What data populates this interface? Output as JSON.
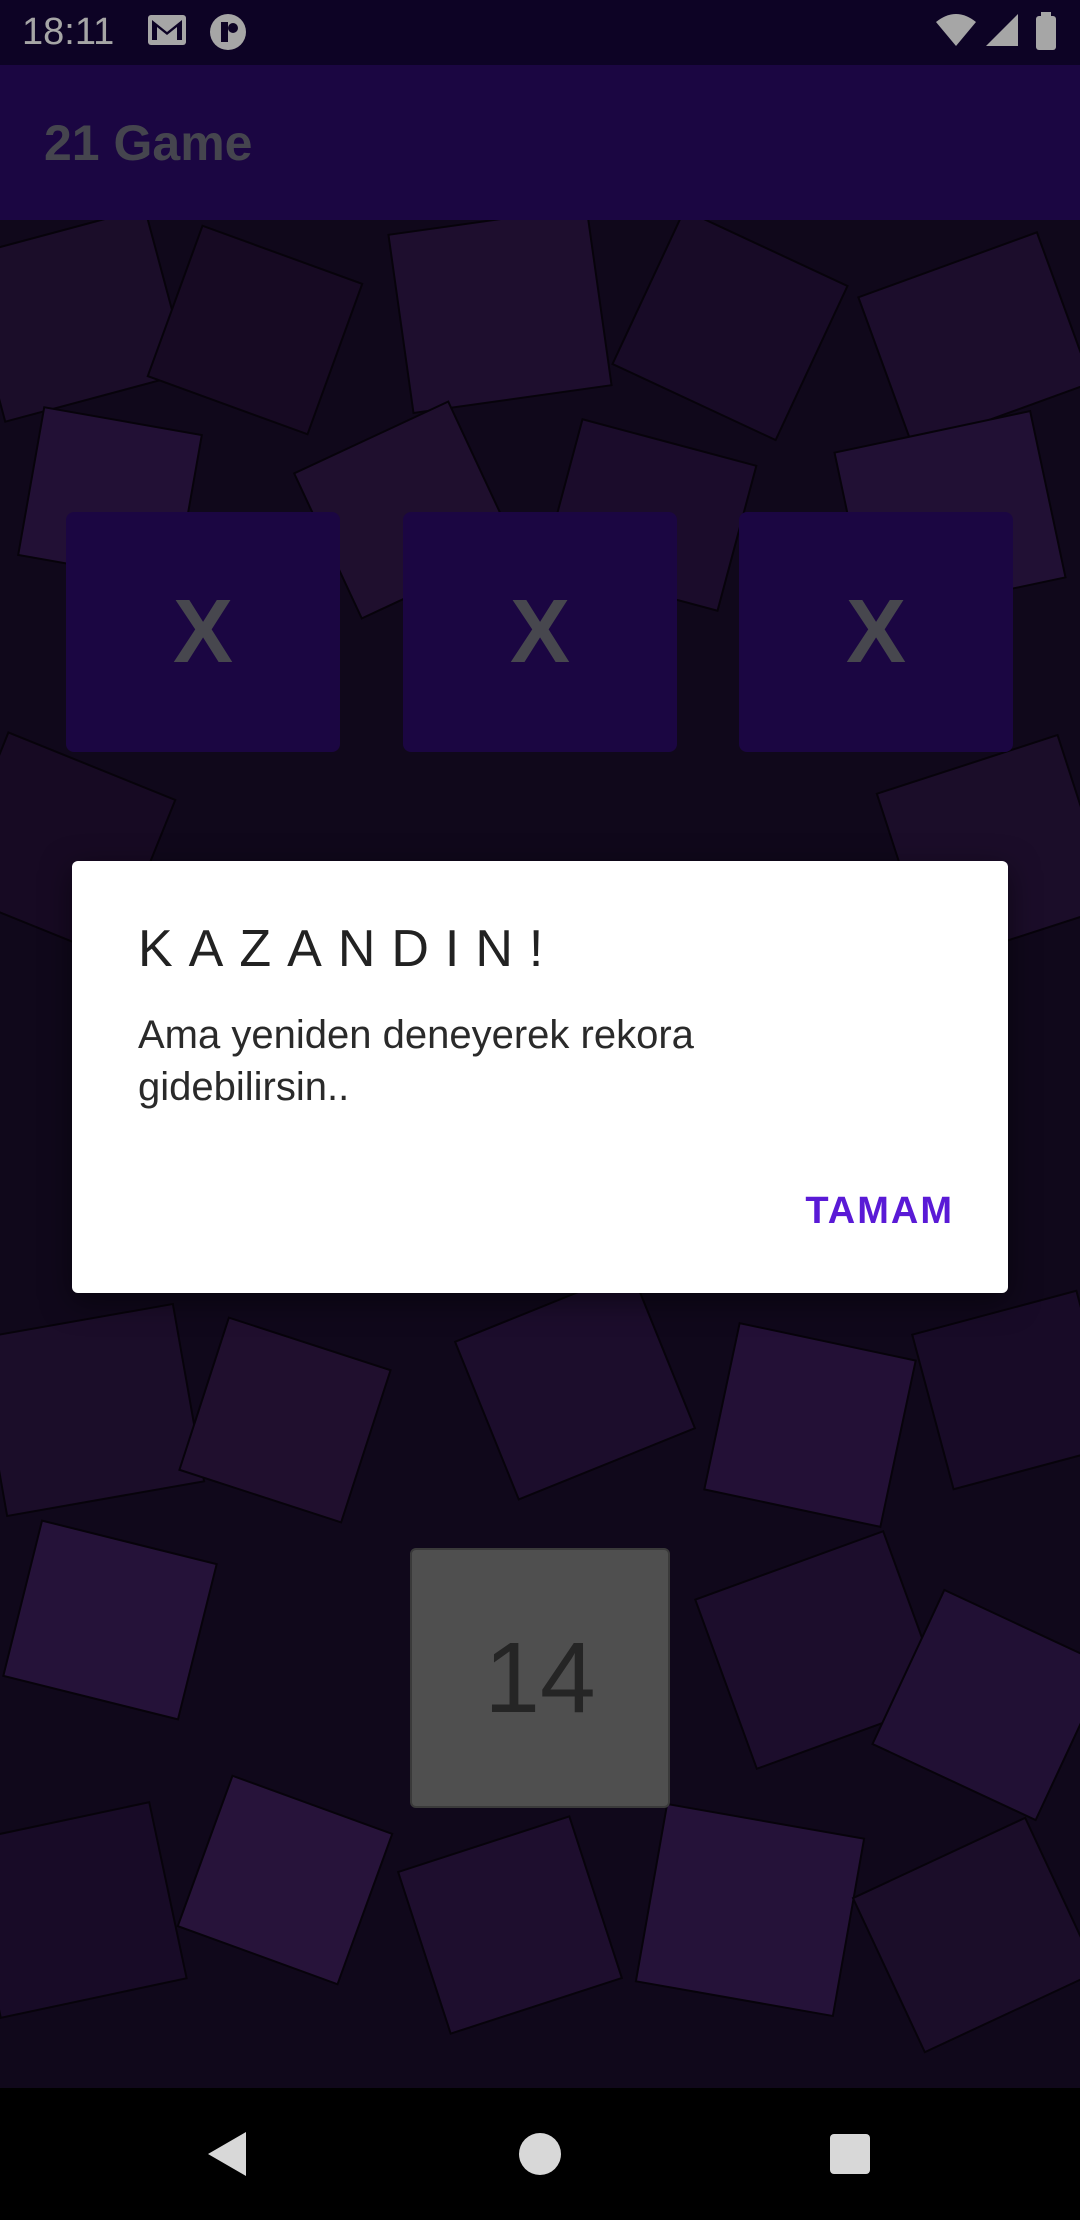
{
  "status_bar": {
    "time": "18:11",
    "left_icons": [
      "gmail-icon",
      "app-notification-icon"
    ],
    "right_icons": [
      "wifi-icon",
      "signal-icon",
      "battery-icon"
    ]
  },
  "app_bar": {
    "title": "21 Game"
  },
  "cards": [
    {
      "label": "X"
    },
    {
      "label": "X"
    },
    {
      "label": "X"
    }
  ],
  "score": {
    "value": "14"
  },
  "dialog": {
    "title": "KAZANDIN!",
    "message": "Ama yeniden deneyerek rekora gidebilirsin..",
    "button_label": "TAMAM"
  },
  "nav_bar": {
    "buttons": [
      "back-icon",
      "home-icon",
      "recents-icon"
    ]
  },
  "colors": {
    "status_bar": "#15063a",
    "app_bar": "#2a0a66",
    "card": "#2a0a66",
    "accent": "#5a1ad6",
    "score_box": "#7a7a7a"
  }
}
